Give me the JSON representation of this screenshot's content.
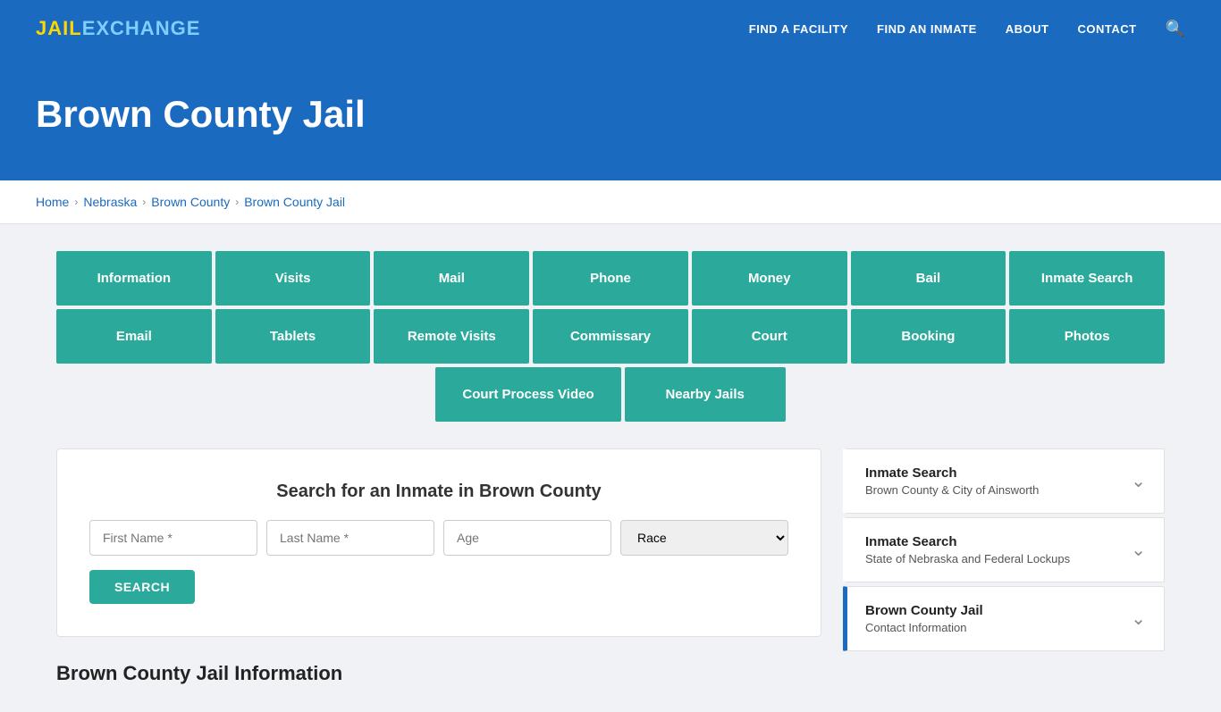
{
  "site": {
    "logo_jail": "JAIL",
    "logo_exchange": "EXCHANGE"
  },
  "nav": {
    "links": [
      {
        "id": "find-facility",
        "label": "FIND A FACILITY"
      },
      {
        "id": "find-inmate",
        "label": "FIND AN INMATE"
      },
      {
        "id": "about",
        "label": "ABOUT"
      },
      {
        "id": "contact",
        "label": "CONTACT"
      }
    ]
  },
  "hero": {
    "title": "Brown County Jail"
  },
  "breadcrumb": {
    "items": [
      {
        "id": "home",
        "label": "Home"
      },
      {
        "id": "nebraska",
        "label": "Nebraska"
      },
      {
        "id": "brown-county",
        "label": "Brown County"
      },
      {
        "id": "brown-county-jail",
        "label": "Brown County Jail"
      }
    ]
  },
  "grid_row1": [
    "Information",
    "Visits",
    "Mail",
    "Phone",
    "Money",
    "Bail",
    "Inmate Search"
  ],
  "grid_row2": [
    "Email",
    "Tablets",
    "Remote Visits",
    "Commissary",
    "Court",
    "Booking",
    "Photos"
  ],
  "grid_row3": [
    "Court Process Video",
    "Nearby Jails"
  ],
  "search": {
    "title": "Search for an Inmate in Brown County",
    "first_name_placeholder": "First Name *",
    "last_name_placeholder": "Last Name *",
    "age_placeholder": "Age",
    "race_placeholder": "Race",
    "button_label": "SEARCH"
  },
  "section_heading": "Brown County Jail Information",
  "sidebar": {
    "items": [
      {
        "id": "inmate-search-county",
        "title": "Inmate Search",
        "sub": "Brown County & City of Ainsworth"
      },
      {
        "id": "inmate-search-state",
        "title": "Inmate Search",
        "sub": "State of Nebraska and Federal Lockups"
      },
      {
        "id": "contact-info",
        "title": "Brown County Jail",
        "sub": "Contact Information"
      }
    ]
  },
  "colors": {
    "teal": "#2ba99b",
    "blue": "#1a6abf"
  }
}
